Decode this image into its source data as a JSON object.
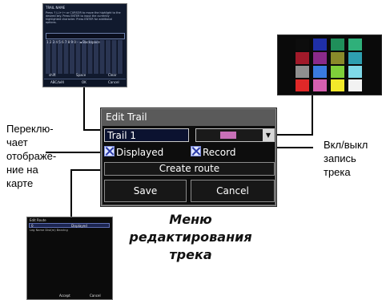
{
  "dialog": {
    "title": "Edit Trail",
    "name_value": "Trail 1",
    "trail_color": "#c870b8",
    "displayed_label": "Displayed",
    "displayed_checked": true,
    "record_label": "Record",
    "record_checked": true,
    "create_route_label": "Create route",
    "save_label": "Save",
    "cancel_label": "Cancel"
  },
  "captions": {
    "left": [
      "Переклю-",
      "чает",
      "отображе-",
      "ние на",
      "карте"
    ],
    "right": [
      "Вкл/выкл",
      "запись",
      "трека"
    ],
    "menu": [
      "Меню",
      "редактирования",
      "трека"
    ]
  },
  "palette": {
    "colors": [
      "#0d0d0d",
      "#1f2fa8",
      "#1f8f5a",
      "#2fb07a",
      "#a11a2a",
      "#8a2a8a",
      "#8a8a2a",
      "#2e9fb0",
      "#8f8f8f",
      "#3a7be0",
      "#7fcf3a",
      "#7fd9e8",
      "#e02828",
      "#d65fb0",
      "#f2e82a",
      "#f2f2f2"
    ]
  },
  "keyboard": {
    "title": "TRAIL NAME",
    "text": "Press ↑/↓/←/→ or CURSOR to move the highlight to the desired key. Press ENTER to input the currently highlighted character. Press ENTER for additional options.",
    "keys": "1 2 3 4 5 6 7 8 9 0 - ◄ Backspace",
    "buttons": [
      "shift",
      "Space",
      "Clear",
      "ABC/áéñ",
      "OK",
      "Cancel"
    ]
  },
  "route_thumb": {
    "title": "Edit Route",
    "name": "0",
    "displayed": "Displayed",
    "header": "Leg Name          Dist(m) Bearing",
    "accept": "Accept",
    "cancel": "Cancel"
  }
}
